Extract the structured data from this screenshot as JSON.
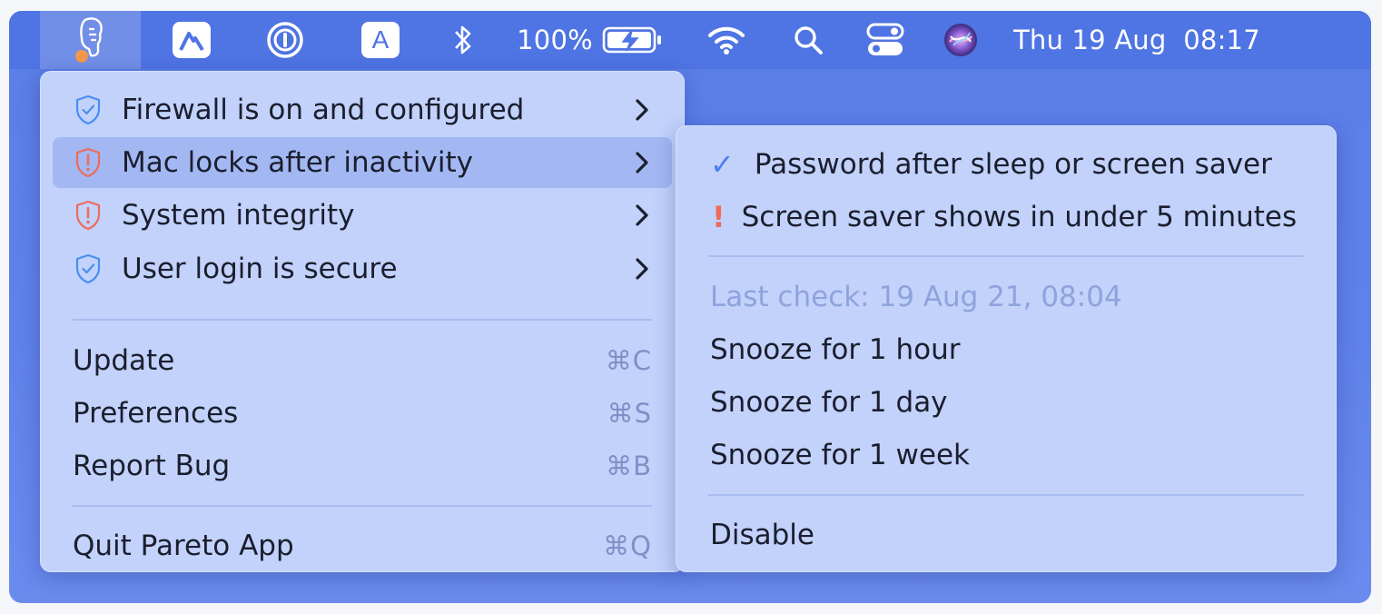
{
  "menubar": {
    "battery_percent": "100%",
    "clock": "Thu 19 Aug  08:17",
    "icons": [
      "pareto-app-icon",
      "nordvpn-icon",
      "onepassword-icon",
      "input-source-a-icon",
      "bluetooth-icon",
      "battery-charging-icon",
      "wifi-icon",
      "spotlight-search-icon",
      "control-center-icon",
      "siri-icon"
    ],
    "input_source_letter": "A"
  },
  "main_menu": {
    "checks": [
      {
        "label": "Firewall is on and configured",
        "status": "ok"
      },
      {
        "label": "Mac locks after inactivity",
        "status": "warn"
      },
      {
        "label": "System integrity",
        "status": "warn"
      },
      {
        "label": "User login is secure",
        "status": "ok"
      }
    ],
    "actions": [
      {
        "label": "Update",
        "shortcut": "⌘C"
      },
      {
        "label": "Preferences",
        "shortcut": "⌘S"
      },
      {
        "label": "Report Bug",
        "shortcut": "⌘B"
      }
    ],
    "quit": {
      "label": "Quit Pareto App",
      "shortcut": "⌘Q"
    }
  },
  "submenu": {
    "items": [
      {
        "label": "Password after sleep or screen saver",
        "mark": "✓"
      },
      {
        "label": "Screen saver shows in under 5 minutes",
        "mark": "!"
      }
    ],
    "last_check": "Last check: 19 Aug 21, 08:04",
    "snooze": [
      "Snooze for 1 hour",
      "Snooze for 1 day",
      "Snooze for 1 week"
    ],
    "disable": "Disable"
  },
  "colors": {
    "ok_icon": "#4a8ef0",
    "warn_icon": "#ee6b5a",
    "menu_bg": "#c2d2fb",
    "highlight": "#a3b8f2",
    "desktop": "#5a7de6"
  }
}
